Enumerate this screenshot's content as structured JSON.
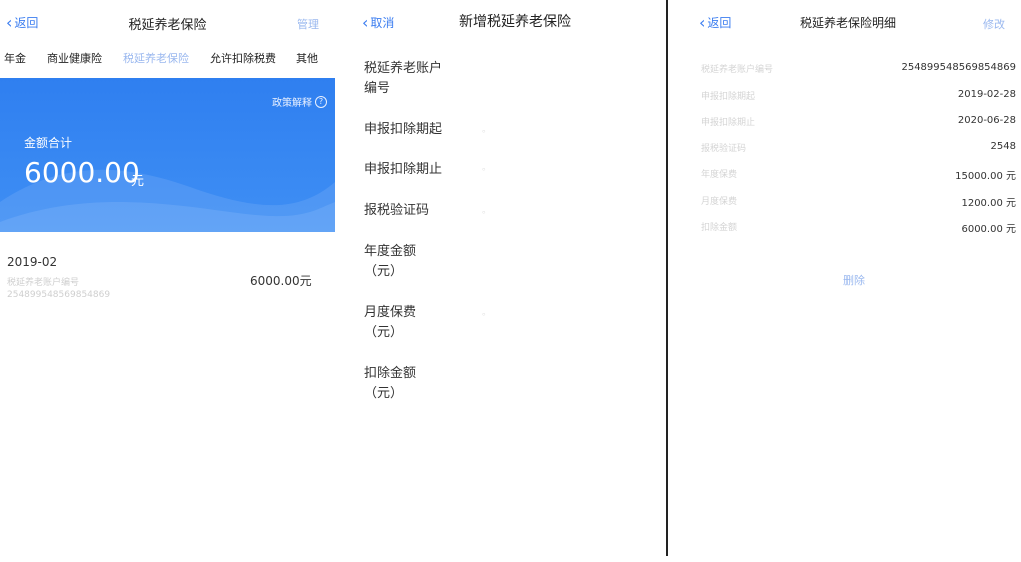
{
  "screen1": {
    "nav": {
      "back": "返回",
      "title": "税延养老保险",
      "right": "管理"
    },
    "tabs": [
      "年金",
      "商业健康险",
      "税延养老保险",
      "允许扣除税费",
      "其他"
    ],
    "banner": {
      "policy": "政策解释",
      "sum_label": "金额合计",
      "sum_value": "6000.00",
      "sum_unit": "元"
    },
    "record": {
      "date": "2019-02",
      "sub1": "税延养老账户编号",
      "sub2": "254899548569854869",
      "amount": "6000.00元"
    }
  },
  "screen2": {
    "nav": {
      "back": "取消",
      "title": "新增税延养老保险"
    },
    "fields": [
      {
        "label": "税延养老账户",
        "label2": "编号",
        "hint": ""
      },
      {
        "label": "申报扣除期起",
        "label2": "",
        "hint": "。"
      },
      {
        "label": "申报扣除期止",
        "label2": "",
        "hint": "。"
      },
      {
        "label": "报税验证码",
        "label2": "",
        "hint": "。"
      },
      {
        "label": "年度金额",
        "label2": "（元）",
        "hint": ""
      },
      {
        "label": "月度保费",
        "label2": "（元）",
        "hint": "。"
      },
      {
        "label": "扣除金额",
        "label2": "（元）",
        "hint": ""
      }
    ]
  },
  "screen3": {
    "nav": {
      "back": "返回",
      "title": "税延养老保险明细",
      "right": "修改"
    },
    "rows": [
      {
        "k": "税延养老账户编号",
        "v": "254899548569854869"
      },
      {
        "k": "申报扣除期起",
        "v": "2019-02-28"
      },
      {
        "k": "申报扣除期止",
        "v": "2020-06-28"
      },
      {
        "k": "报税验证码",
        "v": "2548"
      },
      {
        "k": "年度保费",
        "v": "15000.00 元"
      },
      {
        "k": "月度保费",
        "v": "1200.00 元"
      },
      {
        "k": "扣除金额",
        "v": "6000.00 元"
      }
    ],
    "delete": "删除"
  },
  "colors": {
    "accent": "#2f7ff0",
    "accent_light": "#9ab8ef",
    "text": "#333333"
  }
}
